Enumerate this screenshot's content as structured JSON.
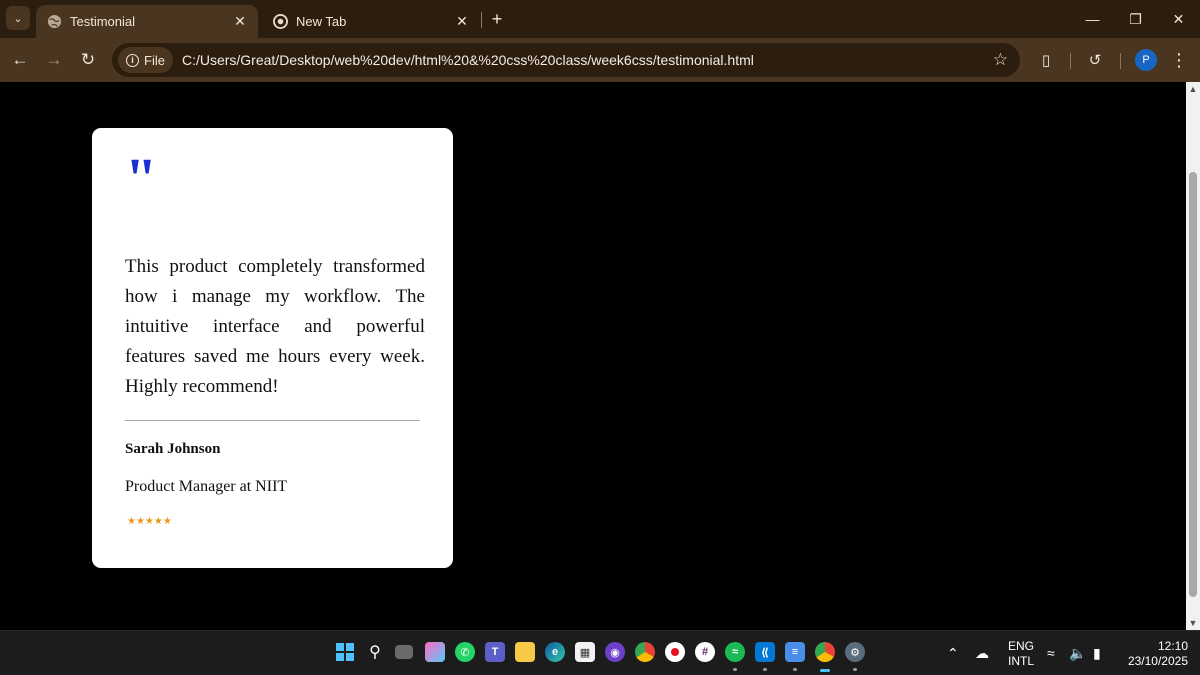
{
  "browser": {
    "tabs": [
      {
        "title": "Testimonial",
        "favicon": "globe-icon",
        "active": true
      },
      {
        "title": "New Tab",
        "favicon": "chrome-icon",
        "active": false
      }
    ],
    "new_tab_label": "+",
    "site_chip_label": "File",
    "url": "C:/Users/Great/Desktop/web%20dev/html%20&%20css%20class/week6css/testimonial.html",
    "profile_initial": "P"
  },
  "testimonial": {
    "quote_mark": "\"",
    "text": "This product completely transformed how i manage my workflow. The intuitive interface and powerful features saved me hours every week. Highly recommend!",
    "author": "Sarah Johnson",
    "role": "Product Manager at NIIT",
    "stars": "★★★★★",
    "rating": 5,
    "quote_color": "#1a2fd0",
    "star_color": "#e89a1a"
  },
  "taskbar": {
    "language": "ENG",
    "layout": "INTL",
    "time": "12:10",
    "date": "23/10/2025"
  }
}
